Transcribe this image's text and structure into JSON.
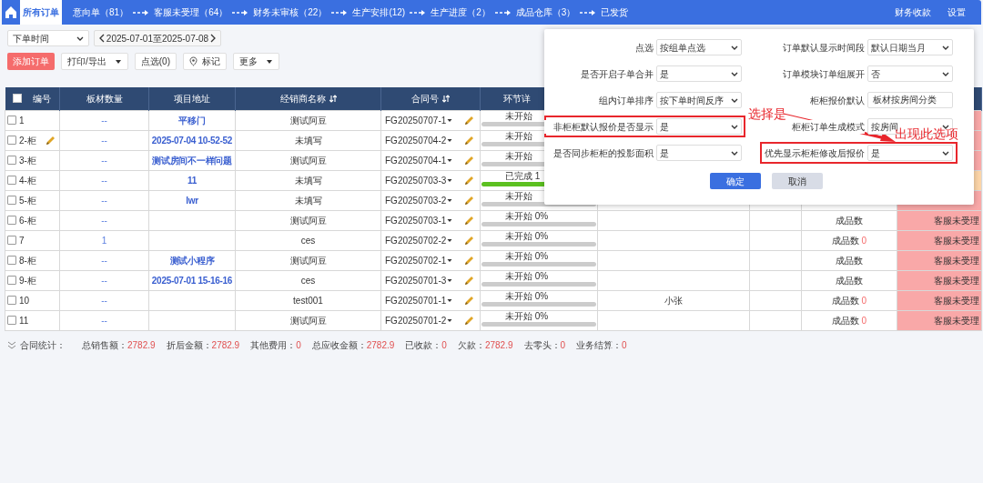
{
  "nav": {
    "tabs": [
      {
        "label": "所有订单",
        "selected": true
      },
      {
        "label": "意向单（81）",
        "selected": false
      },
      {
        "label": "客服未受理（64）",
        "selected": false
      },
      {
        "label": "财务未审核（22）",
        "selected": false
      },
      {
        "label": "生产安排(12)",
        "selected": false
      },
      {
        "label": "生产进度（2）",
        "selected": false
      },
      {
        "label": "成品仓库（3）",
        "selected": false
      },
      {
        "label": "已发货",
        "selected": false
      }
    ],
    "right_links": [
      "财务收款",
      "设置"
    ]
  },
  "filter": {
    "date_field": "下单时间",
    "date_range": "2025-07-01至2025-07-08"
  },
  "actions": [
    {
      "label": "添加订单",
      "kind": "primary"
    },
    {
      "label": "打印/导出",
      "kind": "dropdown"
    },
    {
      "label": "点选(0)",
      "kind": "plain"
    },
    {
      "label": "标记",
      "kind": "pin"
    },
    {
      "label": "更多",
      "kind": "dropdown"
    }
  ],
  "table": {
    "select_all": false,
    "columns": [
      {
        "label": "编号",
        "sortable": false
      },
      {
        "label": "板材数量",
        "sortable": false
      },
      {
        "label": "项目地址",
        "sortable": false
      },
      {
        "label": "经销商名称",
        "sortable": true
      },
      {
        "label": "合同号",
        "sortable": true
      },
      {
        "label": "环节详",
        "sortable": false
      }
    ],
    "rows": [
      {
        "checked": false,
        "number": "1",
        "editable": false,
        "boards": "--",
        "address": "平移门",
        "dealer": "测试阿豆",
        "contract": "FG20250707-1",
        "progress": {
          "text": "未开始",
          "level": 0
        },
        "status": {
          "color": "#f9a8a8"
        }
      },
      {
        "checked": false,
        "number": "2-柜",
        "editable": true,
        "boards": "--",
        "address": "2025-07-04 10-52-52",
        "dealer": "未填写",
        "contract": "FG20250704-2",
        "progress": {
          "text": "未开始",
          "level": 0
        },
        "status": {
          "color": "#f9a8a8"
        }
      },
      {
        "checked": false,
        "number": "3-柜",
        "editable": false,
        "boards": "--",
        "address": "测试房间不一样问题",
        "dealer": "测试阿豆",
        "contract": "FG20250704-1",
        "progress": {
          "text": "未开始",
          "level": 0
        },
        "status": {
          "color": "#f9a8a8"
        }
      },
      {
        "checked": false,
        "number": "4-柜",
        "editable": false,
        "boards": "--",
        "address": "11",
        "dealer": "未填写",
        "contract": "FG20250703-3",
        "progress": {
          "text": "已完成 1",
          "level": 1
        },
        "status": {
          "color": "#fcd5a8"
        }
      },
      {
        "checked": false,
        "number": "5-柜",
        "editable": false,
        "boards": "--",
        "address": "lwr",
        "dealer": "未填写",
        "contract": "FG20250703-2",
        "progress": {
          "text": "未开始",
          "level": 0
        },
        "status": {
          "color": "#f9a8a8"
        }
      },
      {
        "checked": false,
        "number": "6-柜",
        "editable": false,
        "boards": "--",
        "dealer": "测试阿豆",
        "contract": "FG20250703-1",
        "progress": {
          "text": "未开始 0%",
          "level": 0
        },
        "finished": {
          "label": "成品数"
        },
        "status": {
          "color": "#f9a8a8",
          "text": "客服未受理"
        }
      },
      {
        "checked": false,
        "number": "7",
        "editable": false,
        "boards": "1",
        "dealer": "ces",
        "contract": "FG20250702-2",
        "progress": {
          "text": "未开始 0%",
          "level": 0
        },
        "finished": {
          "label": "成品数",
          "count": "0"
        },
        "status": {
          "color": "#f9a8a8",
          "text": "客服未受理"
        }
      },
      {
        "checked": false,
        "number": "8-柜",
        "editable": false,
        "boards": "--",
        "address": "测试小程序",
        "dealer": "测试阿豆",
        "contract": "FG20250702-1",
        "progress": {
          "text": "未开始 0%",
          "level": 0
        },
        "finished": {
          "label": "成品数"
        },
        "status": {
          "color": "#f9a8a8",
          "text": "客服未受理"
        }
      },
      {
        "checked": false,
        "number": "9-柜",
        "editable": false,
        "boards": "--",
        "address": "2025-07-01 15-16-16",
        "dealer": "ces",
        "contract": "FG20250701-3",
        "progress": {
          "text": "未开始 0%",
          "level": 0
        },
        "finished": {
          "label": "成品数"
        },
        "status": {
          "color": "#f9a8a8",
          "text": "客服未受理"
        }
      },
      {
        "checked": false,
        "number": "10",
        "editable": false,
        "boards": "--",
        "dealer": "test001",
        "contract": "FG20250701-1",
        "progress": {
          "text": "未开始 0%",
          "level": 0
        },
        "handler": "小张",
        "finished": {
          "label": "成品数",
          "count": "0"
        },
        "status": {
          "color": "#f9a8a8",
          "text": "客服未受理"
        }
      },
      {
        "checked": false,
        "number": "11",
        "editable": false,
        "boards": "--",
        "dealer": "测试阿豆",
        "contract": "FG20250701-2",
        "progress": {
          "text": "未开始 0%",
          "level": 0
        },
        "finished": {
          "label": "成品数",
          "count": "0"
        },
        "status": {
          "color": "#f9a8a8",
          "text": "客服未受理"
        }
      }
    ]
  },
  "summary": {
    "title": "合同统计：",
    "items": [
      {
        "label": "总销售额：",
        "value": "2782.9"
      },
      {
        "label": "折后金额：",
        "value": "2782.9"
      },
      {
        "label": "其他费用：",
        "value": "0"
      },
      {
        "label": "总应收金额：",
        "value": "2782.9"
      },
      {
        "label": "已收款：",
        "value": "0"
      },
      {
        "label": "欠款：",
        "value": "2782.9"
      },
      {
        "label": "去零头：",
        "value": "0"
      },
      {
        "label": "业务结算：",
        "value": "0"
      }
    ]
  },
  "settings_popup": {
    "fields": [
      {
        "label": "点选",
        "value": "按组单点选",
        "kind": "select",
        "highlighted": false
      },
      {
        "label": "订单默认显示时间段",
        "value": "默认日期当月",
        "kind": "select",
        "highlighted": false
      },
      {
        "label": "是否开启子单合并",
        "value": "是",
        "kind": "select",
        "highlighted": false
      },
      {
        "label": "订单模块订单组展开",
        "value": "否",
        "kind": "select",
        "highlighted": false
      },
      {
        "label": "组内订单排序",
        "value": "按下单时间反序",
        "kind": "select",
        "highlighted": false
      },
      {
        "label": "柜柜报价默认",
        "value": "板材按房间分类",
        "kind": "input",
        "highlighted": false
      },
      {
        "label": "非柜柜默认报价是否显示",
        "value": "是",
        "kind": "select",
        "highlighted": true
      },
      {
        "label": "柜柜订单生成模式",
        "value": "按房间",
        "kind": "select",
        "highlighted": false
      },
      {
        "label": "是否同步柜柜的投影面积",
        "value": "是",
        "kind": "select",
        "highlighted": false
      },
      {
        "label": "优先显示柜柜修改后报价",
        "value": "是",
        "kind": "select",
        "highlighted": true
      }
    ],
    "buttons": [
      {
        "label": "确定",
        "kind": "primary"
      },
      {
        "label": "取消",
        "kind": "secondary"
      }
    ],
    "annotations": [
      {
        "text": "选择是"
      },
      {
        "text": "出现此选项"
      }
    ]
  }
}
